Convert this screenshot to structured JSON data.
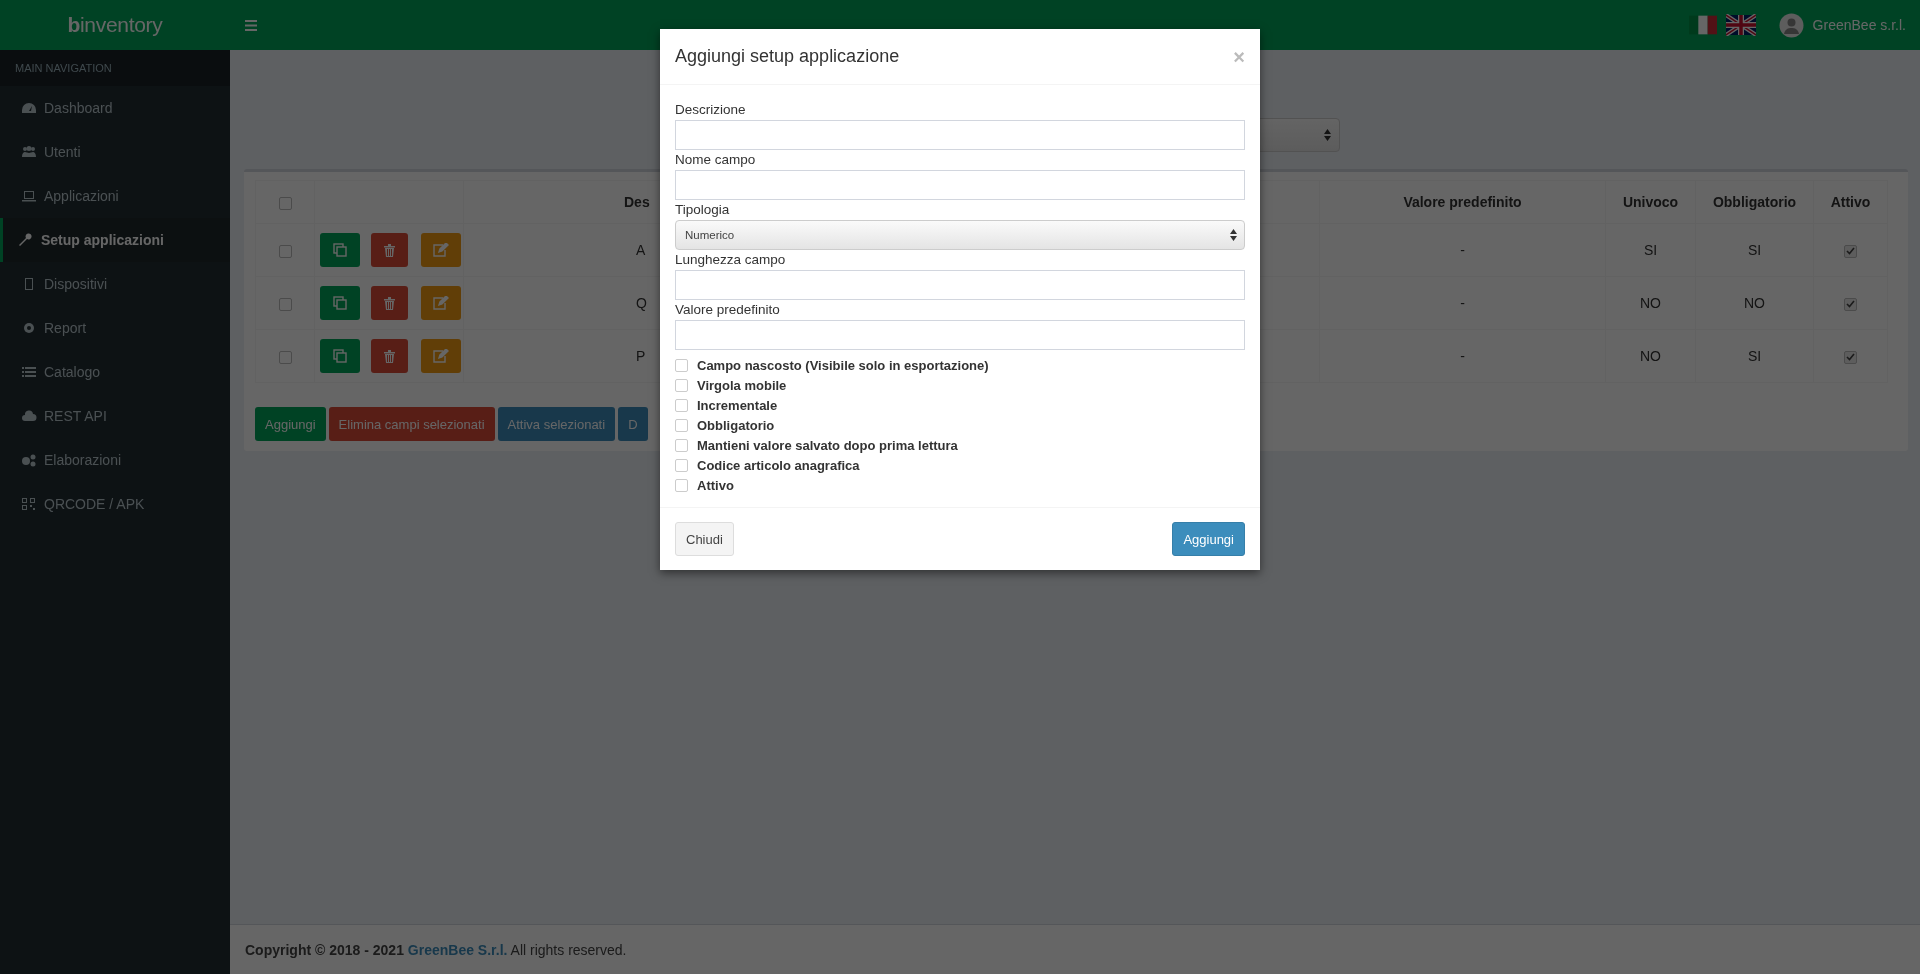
{
  "header": {
    "logo_bold": "b",
    "logo_rest": "inventory",
    "user": "GreenBee s.r.l."
  },
  "sidebar": {
    "heading": "MAIN NAVIGATION",
    "items": [
      {
        "label": "Dashboard",
        "selected": false
      },
      {
        "label": "Utenti",
        "selected": false
      },
      {
        "label": "Applicazioni",
        "selected": false
      },
      {
        "label": "Setup applicazioni",
        "selected": true
      },
      {
        "label": "Dispositivi",
        "selected": false
      },
      {
        "label": "Report",
        "selected": false
      },
      {
        "label": "Catalogo",
        "selected": false
      },
      {
        "label": "REST API",
        "selected": false
      },
      {
        "label": "Elaborazioni",
        "selected": false
      },
      {
        "label": "QRCODE / APK",
        "selected": false
      }
    ]
  },
  "table": {
    "header_checked": false,
    "columns": [
      "Des",
      "Valore predefinito",
      "Univoco",
      "Obbligatorio",
      "Attivo"
    ],
    "rows": [
      {
        "checked": false,
        "column_3": "A",
        "default": "-",
        "unique": "SI",
        "required": "SI",
        "active": true
      },
      {
        "checked": false,
        "column_3": "Q",
        "default": "-",
        "unique": "NO",
        "required": "NO",
        "active": true
      },
      {
        "checked": false,
        "column_3": "P",
        "default": "-",
        "unique": "NO",
        "required": "SI",
        "active": true
      }
    ]
  },
  "actions": [
    {
      "label": "Aggiungi",
      "kind": "success"
    },
    {
      "label": "Elimina campi selezionati",
      "kind": "danger"
    },
    {
      "label": "Attiva selezionati",
      "kind": "primary"
    },
    {
      "label": "D",
      "kind": "primary"
    }
  ],
  "footer": {
    "prefix": "Copyright © 2018 - 2021",
    "link": "GreenBee S.r.l.",
    "suffix": "All rights reserved."
  },
  "modal": {
    "title": "Aggiungi setup applicazione",
    "close": "×",
    "fields": [
      {
        "label": "Descrizione",
        "kind": "text"
      },
      {
        "label": "Nome campo",
        "kind": "text"
      },
      {
        "label": "Tipologia",
        "kind": "select",
        "value": "Numerico"
      },
      {
        "label": "Lunghezza campo",
        "kind": "text"
      },
      {
        "label": "Valore predefinito",
        "kind": "text"
      }
    ],
    "options": [
      {
        "label": "Campo nascosto (Visibile solo in esportazione)",
        "checked": false
      },
      {
        "label": "Virgola mobile",
        "checked": false
      },
      {
        "label": "Incrementale",
        "checked": false
      },
      {
        "label": "Obbligatorio",
        "checked": false
      },
      {
        "label": "Mantieni valore salvato dopo prima lettura",
        "checked": false
      },
      {
        "label": "Codice articolo anagrafica",
        "checked": false
      },
      {
        "label": "Attivo",
        "checked": false
      }
    ],
    "buttons": [
      {
        "label": "Chiudi",
        "kind": "default"
      },
      {
        "label": "Aggiungi",
        "kind": "primary"
      }
    ]
  }
}
